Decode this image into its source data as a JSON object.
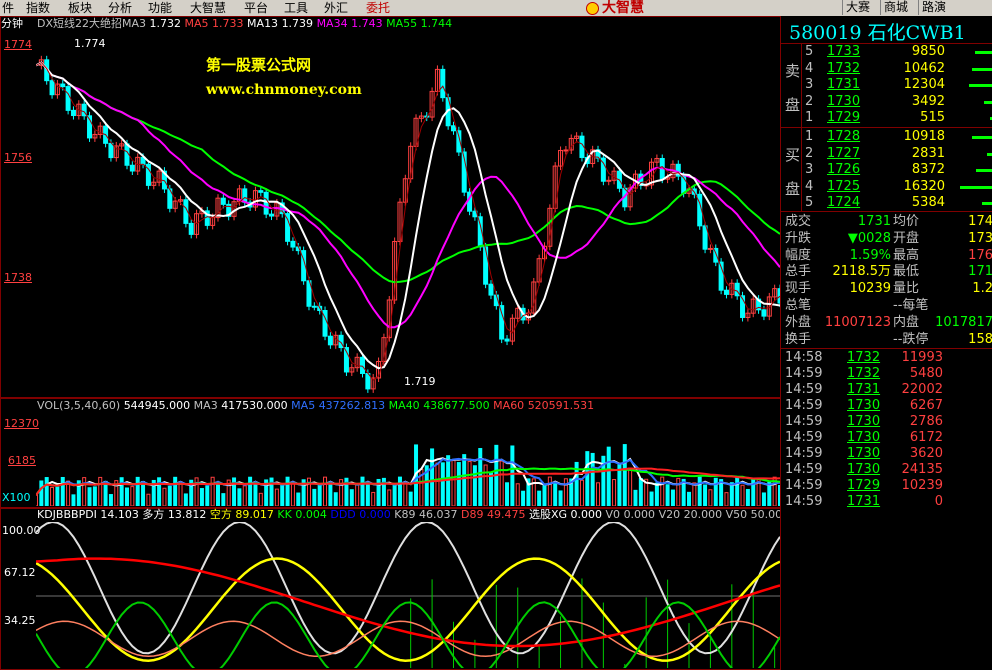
{
  "menu": {
    "items": [
      "件",
      "指数",
      "板块",
      "分析",
      "功能",
      "大智慧",
      "平台",
      "工具",
      "外汇",
      "委托"
    ],
    "brand": "大智慧",
    "right_buttons": [
      "大赛",
      "商城",
      "路演"
    ]
  },
  "colors": {
    "up": "#ff4040",
    "down": "#00ffff",
    "ma5": "#ff4040",
    "ma13": "#ffffff",
    "ma34": "#ff00ff",
    "ma55": "#00ff00",
    "frame": "#800000"
  },
  "period_label": "分钟",
  "watermark": {
    "line1": "第一股票公式网",
    "line2": "www.chnmoney.com"
  },
  "main_indicator": {
    "name": "DX短线22大绝招MA3",
    "ma3_val": "1.732",
    "ma5_label": "MA5",
    "ma5_val": "1.733",
    "ma13_label": "MA13",
    "ma13_val": "1.739",
    "ma34_label": "MA34",
    "ma34_val": "1.743",
    "ma55_label": "MA55",
    "ma55_val": "1.744"
  },
  "price_axis": {
    "ticks": [
      "1774",
      "1756",
      "1738"
    ],
    "high_label": "1.774",
    "low_label": "1.719"
  },
  "vol_indicator": {
    "text1": "VOL(3,5,40,60)",
    "val1": "544945.000",
    "text2": "MA3",
    "val2": "417530.000",
    "text3": "MA5",
    "val3": "437262.813",
    "text4": "MA40",
    "val4": "438677.500",
    "text5": "MA60",
    "val5": "520591.531",
    "ticks": [
      "12370",
      "6185",
      "X100"
    ]
  },
  "kdj_indicator": {
    "items": [
      {
        "label": "KDJBBBPDI",
        "val": "14.103",
        "color": "#ffffff"
      },
      {
        "label": "多方",
        "val": "13.812",
        "color": "#ffffff"
      },
      {
        "label": "空方",
        "val": "89.017",
        "color": "#ffff00"
      },
      {
        "label": "KK",
        "val": "0.004",
        "color": "#00ff00"
      },
      {
        "label": "DDD",
        "val": "0.000",
        "color": "#0000ff"
      },
      {
        "label": "K89",
        "val": "46.037",
        "color": "#c0c0c0"
      },
      {
        "label": "D89",
        "val": "49.475",
        "color": "#ff4040"
      },
      {
        "label": "选股XG",
        "val": "0.000",
        "color": "#ffffff"
      },
      {
        "label": "V0",
        "val": "0.000",
        "color": "#c0c0c0"
      },
      {
        "label": "V20",
        "val": "20.000",
        "color": "#c0c0c0"
      },
      {
        "label": "V50",
        "val": "50.000",
        "color": "#c0c0c0"
      }
    ],
    "ticks": [
      "100.00",
      "67.12",
      "34.25"
    ]
  },
  "quote": {
    "code": "580019",
    "name": "石化CWB1",
    "sell_label": [
      "卖",
      "盘"
    ],
    "buy_label": [
      "买",
      "盘"
    ],
    "sells": [
      {
        "n": "5",
        "price": "1733",
        "vol": "9850",
        "bar": 0.3
      },
      {
        "n": "4",
        "price": "1732",
        "vol": "10462",
        "bar": 0.35
      },
      {
        "n": "3",
        "price": "1731",
        "vol": "12304",
        "bar": 0.4
      },
      {
        "n": "2",
        "price": "1730",
        "vol": "3492",
        "bar": 0.15
      },
      {
        "n": "1",
        "price": "1729",
        "vol": "515",
        "bar": 0.05
      }
    ],
    "buys": [
      {
        "n": "1",
        "price": "1728",
        "vol": "10918",
        "bar": 0.35
      },
      {
        "n": "2",
        "price": "1727",
        "vol": "2831",
        "bar": 0.1
      },
      {
        "n": "3",
        "price": "1726",
        "vol": "8372",
        "bar": 0.28
      },
      {
        "n": "4",
        "price": "1725",
        "vol": "16320",
        "bar": 0.55
      },
      {
        "n": "5",
        "price": "1724",
        "vol": "5384",
        "bar": 0.18
      }
    ],
    "stats": [
      {
        "l1": "成交",
        "v1": "1731",
        "c1": "#00ff00",
        "l2": "均价",
        "v2": "174",
        "c2": "#ffff00"
      },
      {
        "l1": "升跌",
        "v1": "▼0028",
        "c1": "#00ff00",
        "l2": "开盘",
        "v2": "173",
        "c2": "#ffff00"
      },
      {
        "l1": "幅度",
        "v1": "1.59%",
        "c1": "#00ff00",
        "l2": "最高",
        "v2": "176",
        "c2": "#ff4040"
      },
      {
        "l1": "总手",
        "v1": "2118.5万",
        "c1": "#ffff00",
        "l2": "最低",
        "v2": "171",
        "c2": "#00ff00"
      },
      {
        "l1": "现手",
        "v1": "10239",
        "c1": "#ffff00",
        "l2": "量比",
        "v2": "1.2",
        "c2": "#ffff00"
      },
      {
        "l1": "总笔",
        "v1": "",
        "c1": "#ffff00",
        "l2": "--每笔",
        "v2": "",
        "c2": "#c0c0c0"
      },
      {
        "l1": "外盘",
        "v1": "11007123",
        "c1": "#ff4040",
        "l2": "内盘",
        "v2": "1017817",
        "c2": "#00ff00"
      },
      {
        "l1": "换手",
        "v1": "",
        "c1": "#ffff00",
        "l2": "--跌停",
        "v2": "158",
        "c2": "#ffff00"
      }
    ],
    "ticks": [
      {
        "t": "14:58",
        "p": "1732",
        "v": "11993",
        "vc": "#ff4040"
      },
      {
        "t": "14:59",
        "p": "1732",
        "v": "5480",
        "vc": "#ff4040"
      },
      {
        "t": "14:59",
        "p": "1731",
        "v": "22002",
        "vc": "#ff4040"
      },
      {
        "t": "14:59",
        "p": "1730",
        "v": "6267",
        "vc": "#ff4040"
      },
      {
        "t": "14:59",
        "p": "1730",
        "v": "2786",
        "vc": "#ff4040"
      },
      {
        "t": "14:59",
        "p": "1730",
        "v": "6172",
        "vc": "#ff4040"
      },
      {
        "t": "14:59",
        "p": "1730",
        "v": "3620",
        "vc": "#ff4040"
      },
      {
        "t": "14:59",
        "p": "1730",
        "v": "24135",
        "vc": "#ff4040"
      },
      {
        "t": "14:59",
        "p": "1729",
        "v": "10239",
        "vc": "#ff4040"
      },
      {
        "t": "14:59",
        "p": "1731",
        "v": "0",
        "vc": "#ff4040"
      }
    ]
  }
}
